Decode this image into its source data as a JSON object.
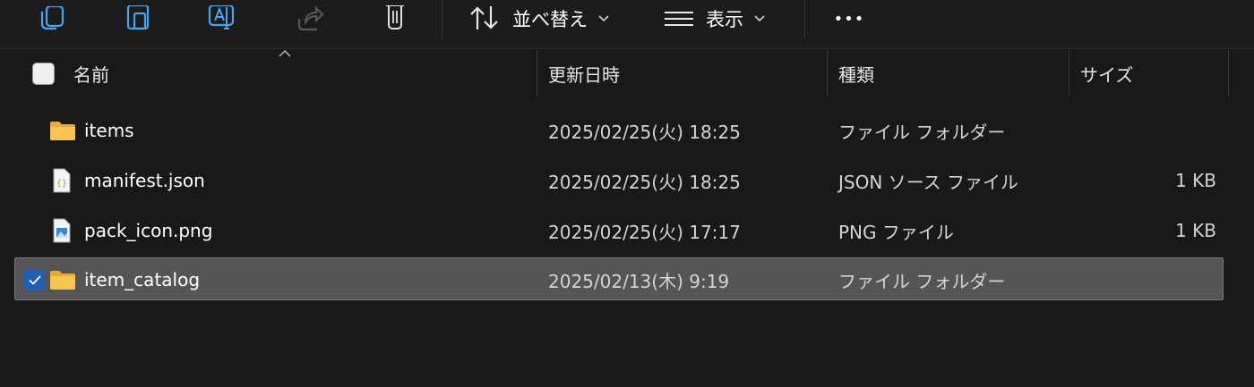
{
  "toolbar": {
    "sort_label": "並べ替え",
    "view_label": "表示",
    "more_label": "•••"
  },
  "columns": {
    "name": "名前",
    "modified": "更新日時",
    "type": "種類",
    "size": "サイズ"
  },
  "files": [
    {
      "name": "items",
      "modified": "2025/02/25(火) 18:25",
      "type": "ファイル フォルダー",
      "size": "",
      "icon": "folder-icon",
      "selected": false
    },
    {
      "name": "manifest.json",
      "modified": "2025/02/25(火) 18:25",
      "type": "JSON ソース ファイル",
      "size": "1 KB",
      "icon": "json-file-icon",
      "selected": false
    },
    {
      "name": "pack_icon.png",
      "modified": "2025/02/25(火) 17:17",
      "type": "PNG ファイル",
      "size": "1 KB",
      "icon": "image-file-icon",
      "selected": false
    },
    {
      "name": "item_catalog",
      "modified": "2025/02/13(木) 9:19",
      "type": "ファイル フォルダー",
      "size": "",
      "icon": "folder-icon",
      "selected": true
    }
  ],
  "colors": {
    "background": "#191919",
    "selection": "#555555",
    "accent": "#1e5fb7",
    "folder": "#f4c14f"
  }
}
